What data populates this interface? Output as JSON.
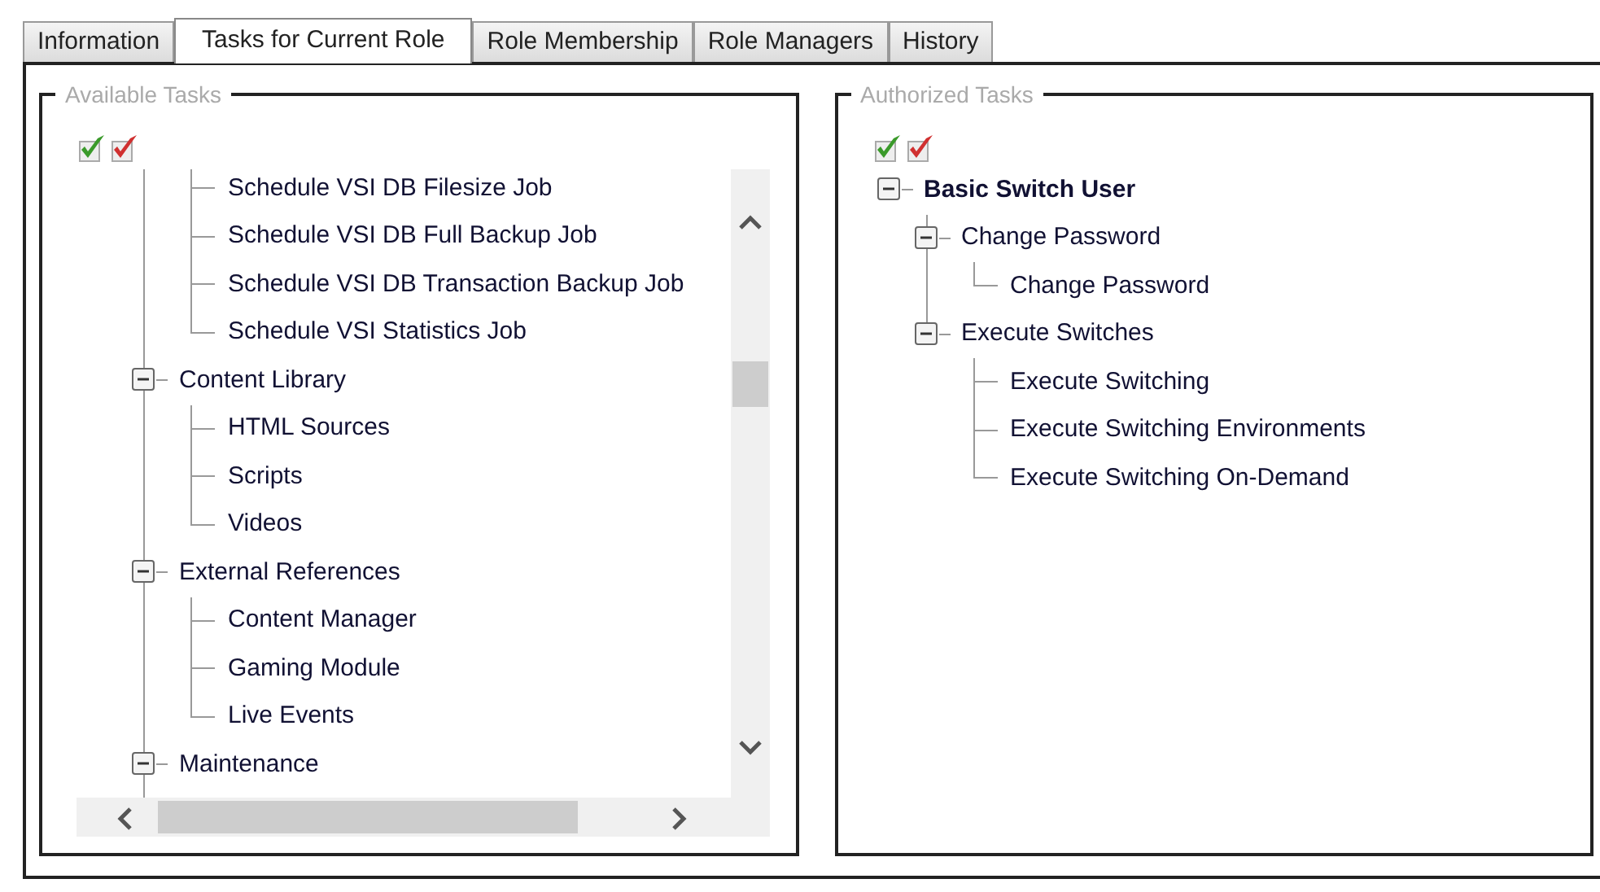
{
  "tabs": [
    {
      "label": "Information",
      "selected": false
    },
    {
      "label": "Tasks for Current Role",
      "selected": true
    },
    {
      "label": "Role Membership",
      "selected": false
    },
    {
      "label": "Role Managers",
      "selected": false
    },
    {
      "label": "History",
      "selected": false
    }
  ],
  "available_tasks": {
    "title": "Available Tasks",
    "tree": [
      {
        "kind": "continued",
        "children": [
          {
            "label": "Schedule VSI DB Filesize Job"
          },
          {
            "label": "Schedule VSI DB Full Backup Job"
          },
          {
            "label": "Schedule VSI DB Transaction Backup Job"
          },
          {
            "label": "Schedule VSI Statistics Job"
          }
        ]
      },
      {
        "kind": "group",
        "label": "Content Library",
        "expanded": true,
        "children": [
          {
            "label": "HTML Sources"
          },
          {
            "label": "Scripts"
          },
          {
            "label": "Videos"
          }
        ]
      },
      {
        "kind": "group",
        "label": "External References",
        "expanded": true,
        "children": [
          {
            "label": "Content Manager"
          },
          {
            "label": "Gaming Module"
          },
          {
            "label": "Live Events"
          }
        ]
      },
      {
        "kind": "group",
        "label": "Maintenance",
        "expanded": true
      }
    ]
  },
  "authorized_tasks": {
    "title": "Authorized Tasks",
    "tree": [
      {
        "label": "Basic Switch User",
        "expanded": true,
        "children": [
          {
            "label": "Change Password",
            "expanded": true,
            "children": [
              {
                "label": "Change Password"
              }
            ]
          },
          {
            "label": "Execute Switches",
            "expanded": true,
            "children": [
              {
                "label": "Execute Switching"
              },
              {
                "label": "Execute Switching Environments"
              },
              {
                "label": "Execute Switching On-Demand"
              }
            ]
          }
        ]
      }
    ]
  }
}
